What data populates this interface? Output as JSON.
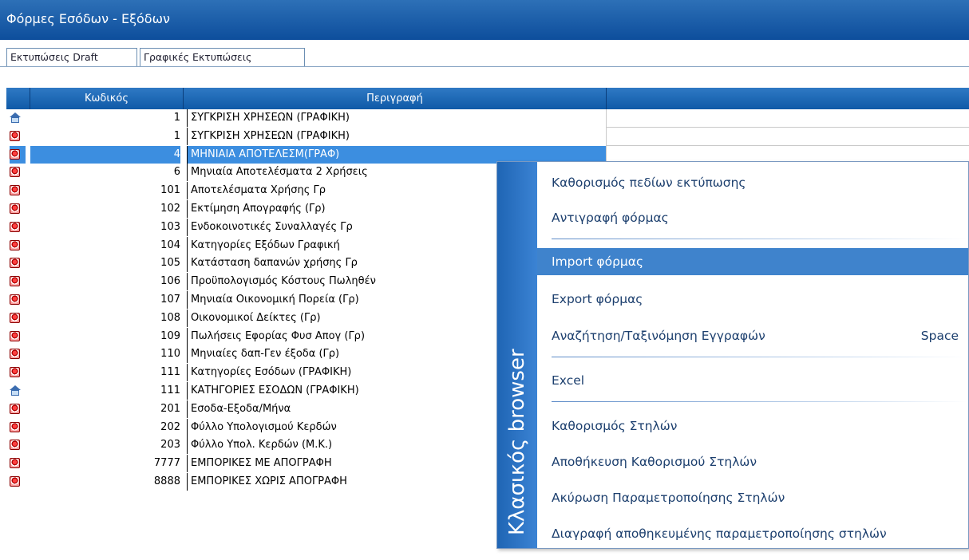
{
  "window": {
    "title": "Φόρμες Εσόδων - Εξόδων"
  },
  "tabs": [
    {
      "label": "Εκτυπώσεις Draft"
    },
    {
      "label": "Γραφικές Εκτυπώσεις"
    }
  ],
  "grid": {
    "columns": [
      "Κωδικός",
      "Περιγραφή"
    ],
    "rows": [
      {
        "icon": "home-icon",
        "code": "1",
        "desc": "ΣΥΓΚΡΙΣΗ ΧΡΗΣΕΩΝ (ΓΡΑΦΙΚΗ)"
      },
      {
        "icon": "gift-icon",
        "code": "1",
        "desc": "ΣΥΓΚΡΙΣΗ ΧΡΗΣΕΩΝ (ΓΡΑΦΙΚΗ)"
      },
      {
        "icon": "gift-icon",
        "code": "4",
        "desc": "ΜΗΝΙΑΙΑ ΑΠΟΤΕΛΕΣΜ(ΓΡΑΦ)"
      },
      {
        "icon": "gift-icon",
        "code": "6",
        "desc": "Μηνιαία Αποτελέσματα 2 Χρήσεις"
      },
      {
        "icon": "gift-icon",
        "code": "101",
        "desc": "Αποτελέσματα Χρήσης Γρ"
      },
      {
        "icon": "gift-icon",
        "code": "102",
        "desc": "Εκτίμηση Απογραφής (Γρ)"
      },
      {
        "icon": "gift-icon",
        "code": "103",
        "desc": "Ενδοκοινοτικές  Συναλλαγές Γρ"
      },
      {
        "icon": "gift-icon",
        "code": "104",
        "desc": "Κατηγορίες Εξόδων Γραφική"
      },
      {
        "icon": "gift-icon",
        "code": "105",
        "desc": "Κατάσταση δαπανών χρήσης Γρ"
      },
      {
        "icon": "gift-icon",
        "code": "106",
        "desc": "Προϋπολογισμός Κόστους Πωληθέν"
      },
      {
        "icon": "gift-icon",
        "code": "107",
        "desc": "Μηνιαία Οικονομική Πορεία (Γρ)"
      },
      {
        "icon": "gift-icon",
        "code": "108",
        "desc": "Οικονομικοί Δείκτες (Γρ)"
      },
      {
        "icon": "gift-icon",
        "code": "109",
        "desc": "Πωλήσεις Εφορίας Φυσ Απογ (Γρ)"
      },
      {
        "icon": "gift-icon",
        "code": "110",
        "desc": "Μηνιαίες δαπ-Γεν έξοδα (Γρ)"
      },
      {
        "icon": "gift-icon",
        "code": "111",
        "desc": "Κατηγορίες Εσόδων (ΓΡΑΦΙΚΗ)"
      },
      {
        "icon": "home-icon",
        "code": "111",
        "desc": "ΚΑΤΗΓΟΡΙΕΣ ΕΣΟΔΩΝ (ΓΡΑΦΙΚΗ)"
      },
      {
        "icon": "gift-icon",
        "code": "201",
        "desc": "Εσοδα-Εξοδα/Μήνα"
      },
      {
        "icon": "gift-icon",
        "code": "202",
        "desc": "Φύλλο Υπολογισμού Κερδών"
      },
      {
        "icon": "gift-icon",
        "code": "203",
        "desc": "Φύλλο Υπολ. Κερδών  (Μ.Κ.)"
      },
      {
        "icon": "gift-icon",
        "code": "7777",
        "desc": "ΕΜΠΟΡΙΚΕΣ ΜΕ ΑΠΟΓΡΑΦΗ"
      },
      {
        "icon": "gift-icon",
        "code": "8888",
        "desc": "ΕΜΠΟΡΙΚΕΣ ΧΩΡΙΣ ΑΠΟΓΡΑΦΗ"
      }
    ]
  },
  "context_menu": {
    "side_label": "Κλασικός browser",
    "items": [
      {
        "label": "Καθορισμός πεδίων εκτύπωσης"
      },
      {
        "label": "Αντιγραφή φόρμας"
      },
      {
        "label": "Import φόρμας"
      },
      {
        "label": "Export φόρμας"
      },
      {
        "label": "Αναζήτηση/Ταξινόμηση Εγγραφών",
        "shortcut": "Space"
      },
      {
        "label": "Excel"
      },
      {
        "label": "Καθορισμός Στηλών"
      },
      {
        "label": "Αποθήκευση Καθορισμού Στηλών"
      },
      {
        "label": "Ακύρωση Παραμετροποίησης Στηλών"
      },
      {
        "label": "Διαγραφή αποθηκευμένης παραμετροποίησης στηλών"
      }
    ]
  }
}
